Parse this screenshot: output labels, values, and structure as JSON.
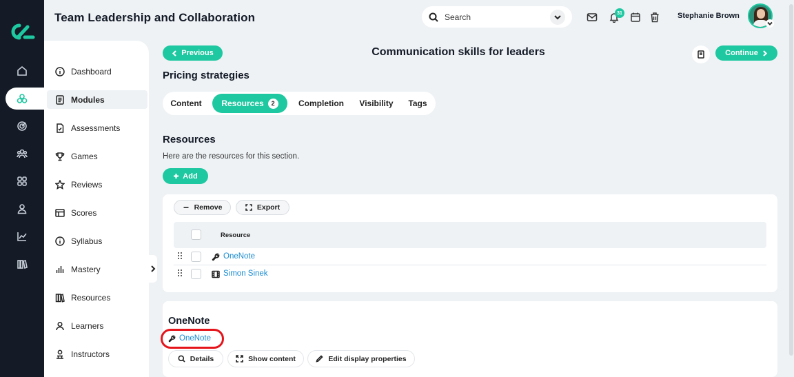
{
  "app": {
    "title": "Team Leadership and Collaboration"
  },
  "header": {
    "search_placeholder": "Search",
    "notification_count": "31",
    "user_name": "Stephanie Brown",
    "icons": [
      "mail-icon",
      "bell-icon",
      "calendar-icon",
      "trash-icon"
    ]
  },
  "rail": {
    "items": [
      "home-icon",
      "modules-icon",
      "target-icon",
      "people-icon",
      "grid-icon",
      "user-icon",
      "chart-icon",
      "library-icon"
    ],
    "active": "modules-icon"
  },
  "sidebar": {
    "items": [
      {
        "label": "Dashboard",
        "icon": "info-icon"
      },
      {
        "label": "Modules",
        "icon": "document-icon",
        "active": true
      },
      {
        "label": "Assessments",
        "icon": "file-check-icon"
      },
      {
        "label": "Games",
        "icon": "trophy-icon"
      },
      {
        "label": "Reviews",
        "icon": "star-icon"
      },
      {
        "label": "Scores",
        "icon": "table-icon"
      },
      {
        "label": "Syllabus",
        "icon": "info-icon"
      },
      {
        "label": "Mastery",
        "icon": "bar-chart-icon"
      },
      {
        "label": "Resources",
        "icon": "books-icon"
      },
      {
        "label": "Learners",
        "icon": "person-icon"
      },
      {
        "label": "Instructors",
        "icon": "instructor-icon"
      }
    ]
  },
  "nav": {
    "previous_label": "Previous",
    "continue_label": "Continue",
    "page_title": "Communication skills for leaders"
  },
  "section": {
    "title": "Pricing strategies"
  },
  "tabs": [
    {
      "label": "Content"
    },
    {
      "label": "Resources",
      "count": "2",
      "active": true
    },
    {
      "label": "Completion"
    },
    {
      "label": "Visibility"
    },
    {
      "label": "Tags"
    }
  ],
  "resources": {
    "title": "Resources",
    "description": "Here are the resources for this section.",
    "add_label": "Add",
    "remove_label": "Remove",
    "export_label": "Export",
    "column_header": "Resource",
    "rows": [
      {
        "name": "OneNote",
        "icon": "wrench-icon"
      },
      {
        "name": "Simon Sinek",
        "icon": "film-icon"
      }
    ]
  },
  "detail": {
    "title": "OneNote",
    "link": "OneNote",
    "buttons": [
      "Details",
      "Show content",
      "Edit display properties"
    ]
  },
  "colors": {
    "accent": "#1ec8a0",
    "rail_bg": "#141b27",
    "link": "#1a8bd1",
    "highlight": "#e5141a"
  }
}
